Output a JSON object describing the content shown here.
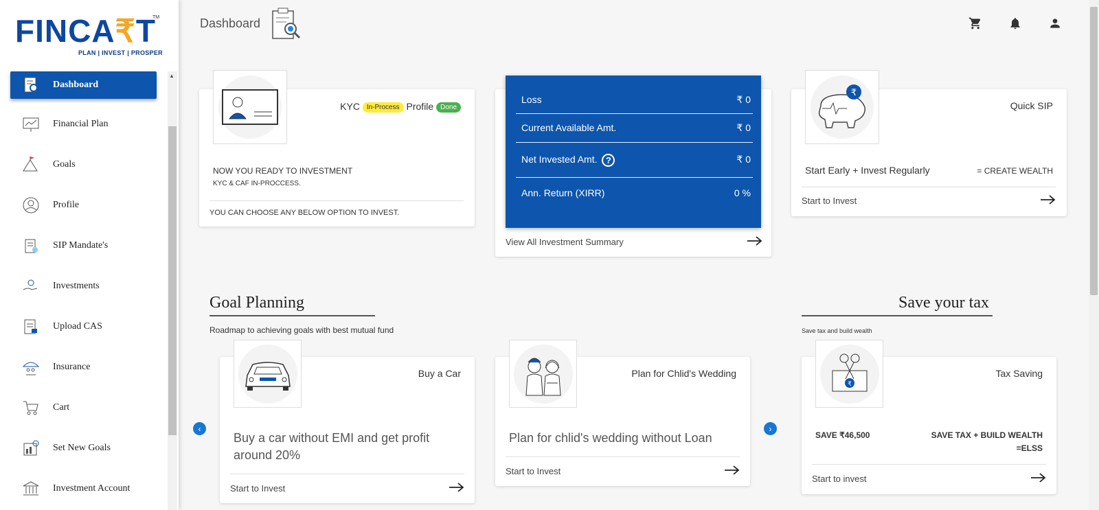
{
  "logo": {
    "text_a": "FINCA",
    "text_r": "₹",
    "text_b": "T",
    "tm": "TM",
    "tagline": "PLAN | INVEST | PROSPER"
  },
  "sidebar": {
    "items": [
      {
        "label": "Dashboard",
        "icon": "dashboard-icon",
        "active": true
      },
      {
        "label": "Financial Plan",
        "icon": "chart-board-icon"
      },
      {
        "label": "Goals",
        "icon": "mountain-flag-icon"
      },
      {
        "label": "Profile",
        "icon": "user-circle-icon"
      },
      {
        "label": "SIP Mandate's",
        "icon": "clipboard-check-icon"
      },
      {
        "label": "Investments",
        "icon": "hand-coins-icon"
      },
      {
        "label": "Upload CAS",
        "icon": "document-upload-icon"
      },
      {
        "label": "Insurance",
        "icon": "umbrella-family-icon"
      },
      {
        "label": "Cart",
        "icon": "cart-icon"
      },
      {
        "label": "Set New Goals",
        "icon": "target-chart-icon"
      },
      {
        "label": "Investment Account",
        "icon": "bank-icon"
      }
    ]
  },
  "header": {
    "title": "Dashboard"
  },
  "kyc": {
    "kyc_label": "KYC",
    "kyc_status": "In-Process",
    "profile_label": "Profile",
    "profile_status": "Done",
    "line1": "NOW YOU READY TO INVESTMENT",
    "line2": "KYC & CAF IN-PROCCESS.",
    "line3": "YOU CAN CHOOSE ANY BELOW OPTION TO INVEST."
  },
  "summary": {
    "rows": [
      {
        "label": "Loss",
        "value": "₹ 0"
      },
      {
        "label": "Current Available Amt.",
        "value": "₹ 0"
      },
      {
        "label": "Net Invested Amt.",
        "value": "₹ 0"
      },
      {
        "label": "Ann. Return (XIRR)",
        "value": "0 %"
      }
    ],
    "link": "View All Investment Summary"
  },
  "quick_sip": {
    "title": "Quick SIP",
    "tagline": "Start Early + Invest Regularly",
    "result": "= CREATE WEALTH",
    "link": "Start to Invest"
  },
  "goal_planning": {
    "title": "Goal Planning",
    "subtitle": "Roadmap to achieving goals with best mutual fund",
    "cards": [
      {
        "title": "Buy a Car",
        "text": "Buy a car without EMI and get profit around 20%",
        "link": "Start to Invest"
      },
      {
        "title": "Plan for Chlid's Wedding",
        "text": "Plan for chlid's wedding without Loan",
        "link": "Start to Invest"
      }
    ]
  },
  "tax": {
    "title": "Save your tax",
    "subtitle": "Save tax and build wealth",
    "card_title": "Tax Saving",
    "save": "SAVE ₹46,500",
    "build": "SAVE TAX + BUILD WEALTH",
    "elss": "=ELSS",
    "link": "Start to invest"
  },
  "colors": {
    "primary": "#0d55ad",
    "badge_yellow": "#ffeb3b",
    "badge_green": "#4caf50"
  }
}
